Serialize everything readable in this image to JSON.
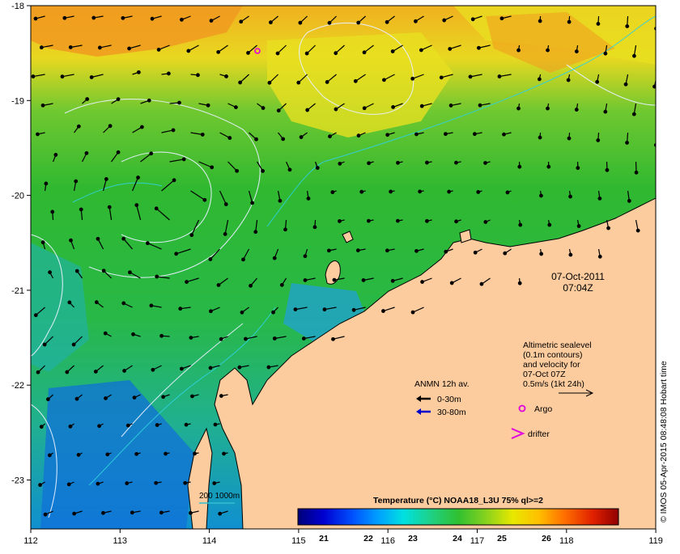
{
  "map": {
    "x_ticks": [
      "112",
      "113",
      "114",
      "115",
      "116",
      "117",
      "118",
      "119"
    ],
    "y_ticks": [
      "-18",
      "-19",
      "-20",
      "-21",
      "-22",
      "-23"
    ],
    "land_color": "#fccb9e"
  },
  "timestamp": {
    "date": "07-Oct-2011",
    "time": "07:04Z"
  },
  "altimetry_note": {
    "lines": [
      "Altimetric sealevel",
      "(0.1m contours)",
      "and velocity for",
      "07-Oct 07Z",
      "0.5m/s (1kt 24h)"
    ]
  },
  "anmn_legend": {
    "title": "ANMN 12h av.",
    "items": [
      {
        "label": "0-30m",
        "color": "#000000"
      },
      {
        "label": "30-80m",
        "color": "#0000cc"
      }
    ]
  },
  "markers": {
    "argo_label": "Argo",
    "argo_color": "#e000e0",
    "drifter_label": "drifter",
    "drifter_color": "#e000e0"
  },
  "depth_legend": {
    "label": "200  1000m",
    "color": "#30c0d0"
  },
  "colorbar": {
    "title": "Temperature (°C) NOAA18_L3U 75% ql>=2",
    "tick_labels": [
      "21",
      "22",
      "23",
      "24",
      "25",
      "26"
    ],
    "stops": [
      "#00007a",
      "#0000d0",
      "#0050ff",
      "#00a0ff",
      "#00e0e0",
      "#20d080",
      "#30c030",
      "#80d020",
      "#e8e800",
      "#ffc000",
      "#ff7000",
      "#e02000",
      "#900000"
    ]
  },
  "credit": "© IMOS 05-Apr-2015 08:48:08 Hobart time"
}
